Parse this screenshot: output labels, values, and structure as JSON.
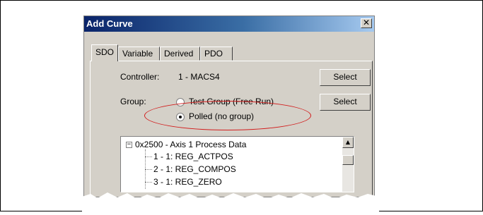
{
  "dialog": {
    "title": "Add Curve",
    "close_glyph": "✕",
    "tabs": [
      {
        "label": "SDO",
        "active": true
      },
      {
        "label": "Variable",
        "active": false
      },
      {
        "label": "Derived",
        "active": false
      },
      {
        "label": "PDO",
        "active": false
      }
    ],
    "controller": {
      "label": "Controller:",
      "value": "1 - MACS4",
      "button": "Select"
    },
    "group": {
      "label": "Group:",
      "button": "Select",
      "options": [
        {
          "label": "Test Group (Free Run)",
          "selected": false
        },
        {
          "label": "Polled (no group)",
          "selected": true
        }
      ]
    },
    "tree": {
      "root": {
        "label": "0x2500 - Axis 1 Process Data",
        "expander": "−"
      },
      "children": [
        "1 - 1: REG_ACTPOS",
        "2 - 1: REG_COMPOS",
        "3 - 1: REG_ZERO"
      ]
    },
    "scrollbar": {
      "up_glyph": "▲"
    }
  },
  "annotation": {
    "color": "#d21c1c"
  }
}
